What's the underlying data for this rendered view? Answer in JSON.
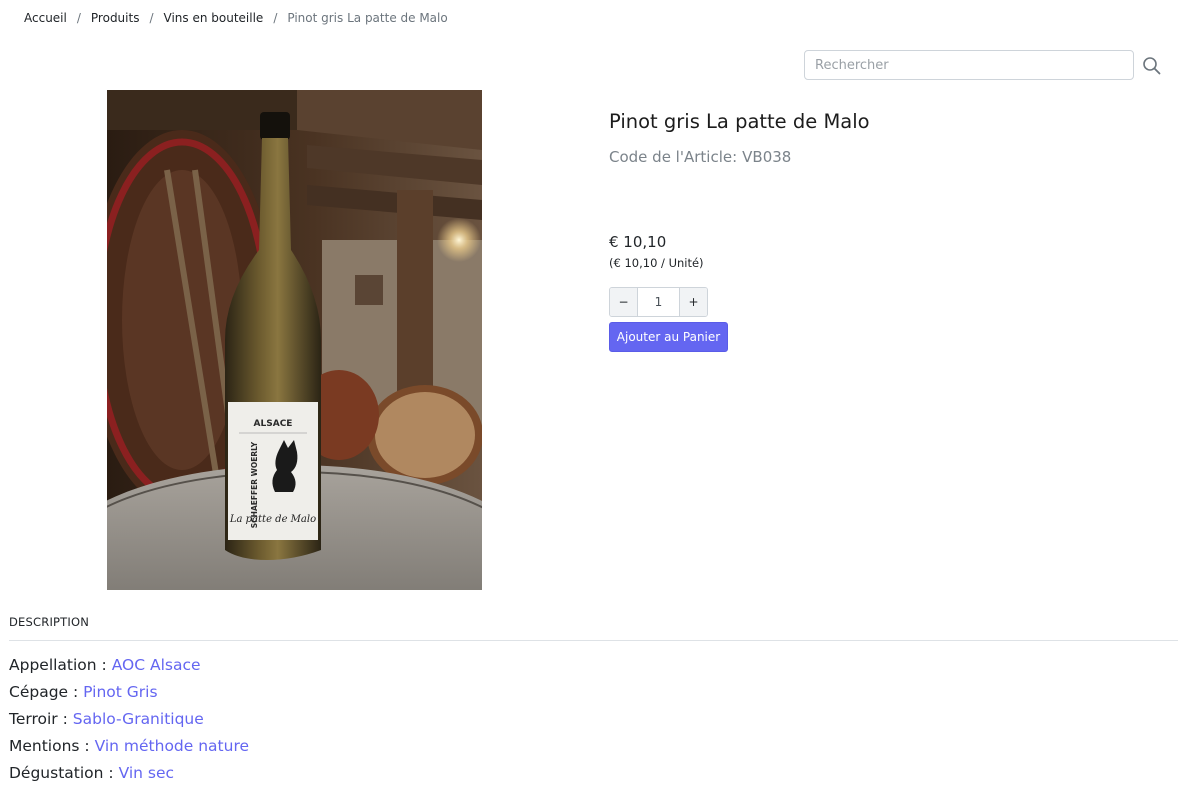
{
  "breadcrumb": {
    "items": [
      "Accueil",
      "Produits",
      "Vins en bouteille"
    ],
    "current": "Pinot gris La patte de Malo",
    "separator": "/"
  },
  "search": {
    "placeholder": "Rechercher",
    "icon": "search-icon"
  },
  "product": {
    "title": "Pinot gris La patte de Malo",
    "code_label": "Code de l'Article:",
    "code": "VB038",
    "price": "€ 10,10",
    "unit_price": "(€ 10,10 / Unité)",
    "quantity": "1",
    "minus_label": "−",
    "plus_label": "+",
    "add_to_cart": "Ajouter au Panier",
    "image_label": {
      "region": "ALSACE",
      "brand": "SCHAEFFER WOERLY",
      "cuvee": "La patte de Malo"
    }
  },
  "description": {
    "title": "DESCRIPTION",
    "attributes": [
      {
        "label": "Appellation :",
        "value": "AOC Alsace"
      },
      {
        "label": "Cépage :",
        "value": "Pinot Gris"
      },
      {
        "label": "Terroir :",
        "value": "Sablo-Granitique"
      },
      {
        "label": "Mentions :",
        "value": "Vin méthode nature"
      },
      {
        "label": "Dégustation :",
        "value": "Vin sec"
      }
    ]
  },
  "colors": {
    "accent": "#6466f1",
    "muted": "#7b838a",
    "border": "#ced4da"
  }
}
